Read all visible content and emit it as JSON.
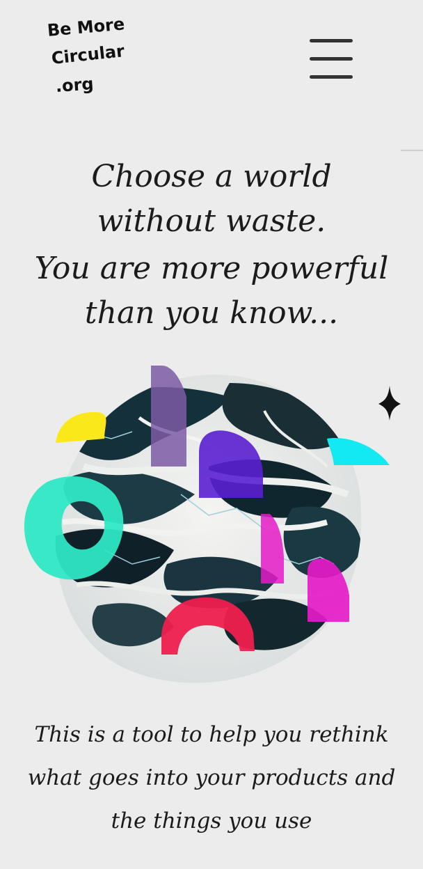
{
  "logo": {
    "line1": "Be More",
    "line2": "Circular",
    "line3": ".org"
  },
  "menu": {
    "icon": "hamburger-menu-icon"
  },
  "hero": {
    "headline": "Choose a world without waste.",
    "subheadline": "You are more powerful than you know..."
  },
  "illustration": {
    "icon": "collage-globe-illustration",
    "colors": {
      "yellow": "#fbe81b",
      "teal": "#2ee8c4",
      "cyan": "#12e9f2",
      "purple": "#5a1fd0",
      "lavender": "#7c5aa6",
      "magenta": "#e51bc8",
      "red": "#ef1f4e",
      "marble_dark": "#14303a"
    }
  },
  "description": {
    "text": "This is a tool to help you rethink what goes into your products and the things you use"
  }
}
